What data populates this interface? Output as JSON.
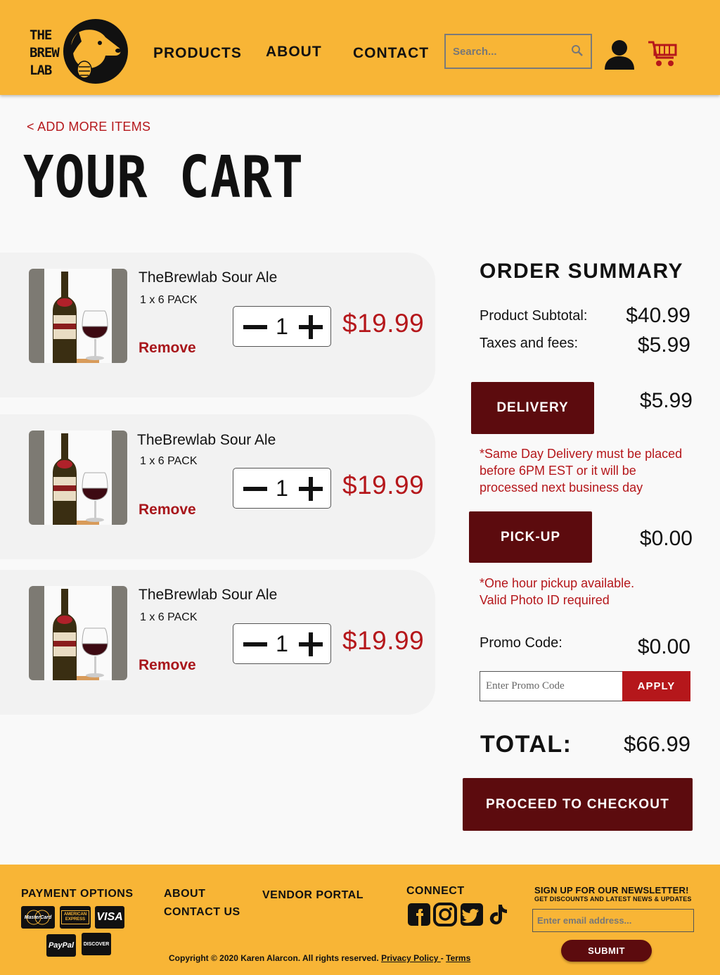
{
  "header": {
    "logo_lines": [
      "THE",
      "BREW",
      "LAB"
    ],
    "nav": {
      "products": "PRODUCTS",
      "about": "ABOUT",
      "contact": "CONTACT"
    },
    "search": {
      "placeholder": "Search..."
    },
    "icons": [
      "dog-logo-icon",
      "search-icon",
      "user-icon",
      "cart-icon"
    ]
  },
  "back_link": "< ADD MORE ITEMS",
  "page_title": "YOUR CART",
  "cart": {
    "items": [
      {
        "name": "TheBrewlab Sour Ale",
        "pack": "1 x 6 PACK",
        "remove": "Remove",
        "qty": "1",
        "price": "$19.99"
      },
      {
        "name": "TheBrewlab Sour Ale",
        "pack": "1 x 6 PACK",
        "remove": "Remove",
        "qty": "1",
        "price": "$19.99"
      },
      {
        "name": "TheBrewlab Sour Ale",
        "pack": "1 x 6 PACK",
        "remove": "Remove",
        "qty": "1",
        "price": "$19.99"
      }
    ]
  },
  "summary": {
    "title": "ORDER SUMMARY",
    "subtotal_label": "Product Subtotal:",
    "subtotal_value": "$40.99",
    "taxes_label": "Taxes and fees:",
    "taxes_value": "$5.99",
    "delivery_button": "DELIVERY",
    "delivery_value": "$5.99",
    "delivery_note": "*Same Day Delivery must be placed before 6PM EST or it will be processed next business day",
    "pickup_button": "PICK-UP",
    "pickup_value": "$0.00",
    "pickup_note": "*One hour pickup available. Valid Photo ID required",
    "promo_label": "Promo Code:",
    "promo_value": "$0.00",
    "promo_placeholder": "Enter Promo Code",
    "apply_button": "APPLY",
    "total_label": "TOTAL:",
    "total_value": "$66.99",
    "checkout_button": "PROCEED TO CHECKOUT"
  },
  "footer": {
    "payment_title": "PAYMENT OPTIONS",
    "cards": [
      "MasterCard",
      "AMERICAN EXPRESS",
      "VISA",
      "PayPal",
      "DISCOVER"
    ],
    "about": "ABOUT",
    "contact_us": "CONTACT US",
    "vendor_portal": "VENDOR PORTAL",
    "connect": "CONNECT",
    "social_icons": [
      "facebook-icon",
      "instagram-icon",
      "twitter-icon",
      "tiktok-icon"
    ],
    "newsletter_title": "SIGN UP FOR OUR NEWSLETTER!",
    "newsletter_sub": "GET DISCOUNTS AND LATEST NEWS & UPDATES",
    "email_placeholder": "Enter email address...",
    "submit": "SUBMIT",
    "copyright": "Copyright © 2020 Karen Alarcon. All rights reserved.",
    "privacy": "Privacy Policy ",
    "separator": "-",
    "terms": "Terms"
  },
  "colors": {
    "brand_yellow": "#f8b536",
    "accent_red": "#b5171b",
    "dark_maroon": "#5c0b0e"
  }
}
